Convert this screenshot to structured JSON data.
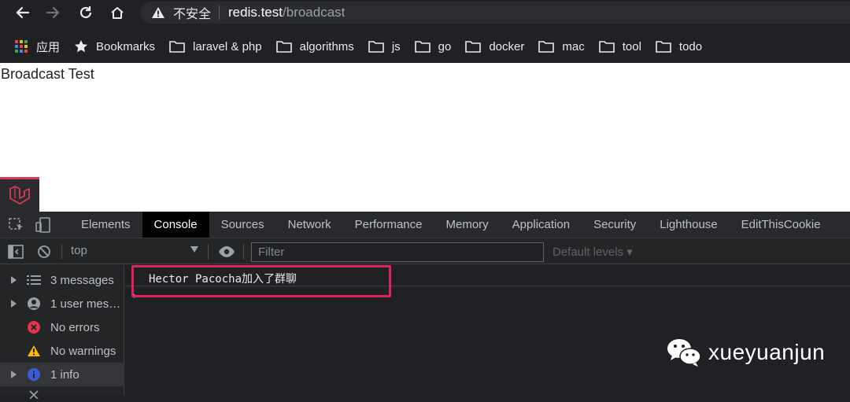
{
  "browser": {
    "insecure_label": "不安全",
    "url_host": "redis.test",
    "url_path": "/broadcast"
  },
  "bookmarks": {
    "apps_label": "应用",
    "bookmarks_label": "Bookmarks",
    "folders": [
      "laravel & php",
      "algorithms",
      "js",
      "go",
      "docker",
      "mac",
      "tool",
      "todo"
    ]
  },
  "page": {
    "title": "Broadcast Test"
  },
  "devtools": {
    "tabs": [
      "Elements",
      "Console",
      "Sources",
      "Network",
      "Performance",
      "Memory",
      "Application",
      "Security",
      "Lighthouse",
      "EditThisCookie"
    ],
    "active_tab": "Console",
    "context": "top",
    "filter_placeholder": "Filter",
    "levels": "Default levels ▾",
    "sidebar": [
      {
        "label": "3 messages",
        "icon": "list-icon"
      },
      {
        "label": "1 user mes…",
        "icon": "user-icon"
      },
      {
        "label": "No errors",
        "icon": "error-icon"
      },
      {
        "label": "No warnings",
        "icon": "warning-icon"
      },
      {
        "label": "1 info",
        "icon": "info-icon"
      }
    ],
    "console_message": "Hector Pacocha加入了群聊"
  },
  "watermark": {
    "text": "xueyuanjun"
  },
  "colors": {
    "highlight": "#e0245e",
    "laravel_red": "#d23a57"
  }
}
